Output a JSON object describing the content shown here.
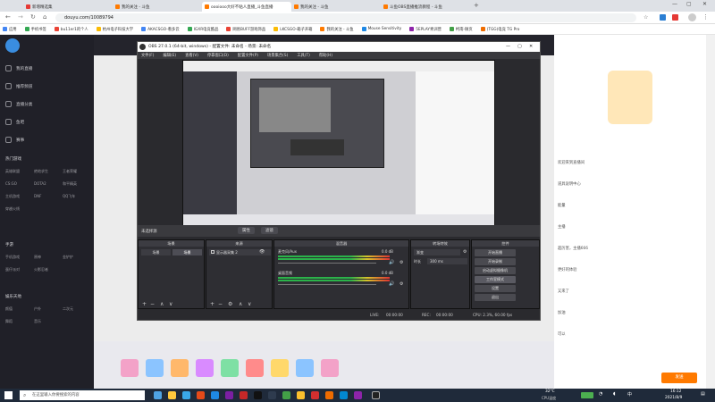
{
  "browser": {
    "tabs": [
      {
        "label": "新增精选集",
        "active": false
      },
      {
        "label": "我的关注 - 斗鱼",
        "active": false
      },
      {
        "label": "oooiooo大好不粘人直播_斗鱼直播",
        "active": true
      },
      {
        "label": "我的关注 - 斗鱼",
        "active": false
      },
      {
        "label": "斗鱼OBS直播推流教程 - 斗鱼",
        "active": false
      }
    ],
    "url": "douyu.com/10089794",
    "bookmarks": [
      "应用",
      "手机书签",
      "bu11er1的个人",
      "杭州电子科技大学",
      "AKACSGO-看多云",
      "IGXR电竞酷品",
      "网易BUFF游戏饰品",
      "LKCSGO-箱子开箱",
      "我的关注 - 斗鱼",
      "Mouse Sensitivity",
      "5EPLAY青训营",
      "柯南-微页",
      "(TGG)电竞 TG Pro"
    ]
  },
  "leftnav": {
    "items": [
      "我的直播",
      "推荐频道",
      "直播分类",
      "鱼吧",
      "赛事"
    ],
    "section1": "热门游戏",
    "categories1": [
      "英雄联盟",
      "绝地求生",
      "王者荣耀",
      "CS:GO",
      "DOTA2",
      "和平精英",
      "主机游戏",
      "DNF",
      "QQ飞车",
      "穿越火线"
    ],
    "section2": "手游",
    "categories2": [
      "手机游戏",
      "原神",
      "金铲铲",
      "蛋仔派对",
      "火影忍者"
    ],
    "section3": "娱乐天地",
    "categories3": [
      "颜值",
      "户外",
      "二次元",
      "舞蹈",
      "音乐"
    ]
  },
  "obs": {
    "title": "OBS 27.0.1 (64-bit, windows) - 配置文件: 未命名 - 场景: 未命名",
    "menu": [
      "文件(F)",
      "编辑(E)",
      "查看(V)",
      "停靠窗口(D)",
      "配置文件(P)",
      "场景集合(S)",
      "工具(T)",
      "帮助(H)"
    ],
    "no_source": "未选择源",
    "props_button": "属性",
    "filters_button": "滤镜",
    "docks": {
      "scenes": "场景",
      "sources": "来源",
      "mixer": "混音器",
      "transitions": "转场特效",
      "controls": "控件"
    },
    "scene_tab1": "场景",
    "scene_tab2": "场景",
    "source_item": "显示器采集 2",
    "mixer_track1": "麦克风/Aux",
    "mixer_track1_db": "0.0 dB",
    "mixer_track2": "桌面音频",
    "mixer_track2_db": "0.0 dB",
    "transition_type": "渐变",
    "duration_label": "时长",
    "duration_value": "300 ms",
    "controls": [
      "开始直播",
      "开始录制",
      "启动虚拟摄像机",
      "工作室模式",
      "设置",
      "退出"
    ],
    "status": {
      "live_label": "LIVE:",
      "live_time": "00:00:00",
      "rec_label": "REC:",
      "rec_time": "00:00:00",
      "cpu": "CPU: 2.3%, 60.00 fps"
    }
  },
  "chat": {
    "lines": [
      {
        "user": "",
        "text": "欢迎来到直播间"
      },
      {
        "user": "",
        "text": "道具说明中心"
      },
      {
        "user": "",
        "text": "能量"
      },
      {
        "user": "",
        "text": "主播"
      },
      {
        "user": "",
        "text": "超厉害，主播666"
      },
      {
        "user": "",
        "text": "更好的体验"
      },
      {
        "user": "",
        "text": "又来了"
      },
      {
        "user": "",
        "text": "加油"
      },
      {
        "user": "",
        "text": "可以"
      }
    ],
    "send_button": "发送"
  },
  "taskbar": {
    "search_placeholder": "在这里输入你要搜索的内容",
    "weather": "32°C",
    "weather_sub": "CPU温度",
    "time": "16:12",
    "date": "2021/8/9"
  }
}
